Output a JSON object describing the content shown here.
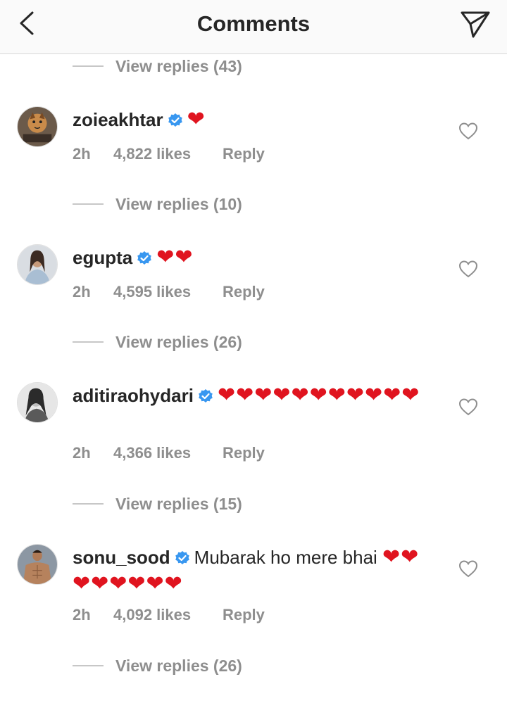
{
  "header": {
    "title": "Comments",
    "back_icon": "chevron-left-icon",
    "send_icon": "paper-plane-icon"
  },
  "view_replies_top": "View replies (43)",
  "comments": [
    {
      "username": "zoieakhtar",
      "verified": true,
      "text": "❤",
      "time": "2h",
      "likes": "4,822 likes",
      "reply": "Reply",
      "view_replies": "View replies (10)"
    },
    {
      "username": "egupta",
      "verified": true,
      "text": "❤❤",
      "time": "2h",
      "likes": "4,595 likes",
      "reply": "Reply",
      "view_replies": "View replies (26)"
    },
    {
      "username": "aditiraohydari",
      "verified": true,
      "text": "❤❤❤❤❤❤❤❤❤❤❤",
      "time": "2h",
      "likes": "4,366 likes",
      "reply": "Reply",
      "view_replies": "View replies (15)"
    },
    {
      "username": "sonu_sood",
      "verified": true,
      "text": "Mubarak ho mere bhai",
      "emoji": "❤❤❤❤❤❤❤❤",
      "time": "2h",
      "likes": "4,092 likes",
      "reply": "Reply",
      "view_replies": "View replies (26)"
    }
  ],
  "colors": {
    "verified_blue": "#3897f0",
    "heart_red": "#e0141f",
    "secondary_text": "#8e8e8e"
  }
}
